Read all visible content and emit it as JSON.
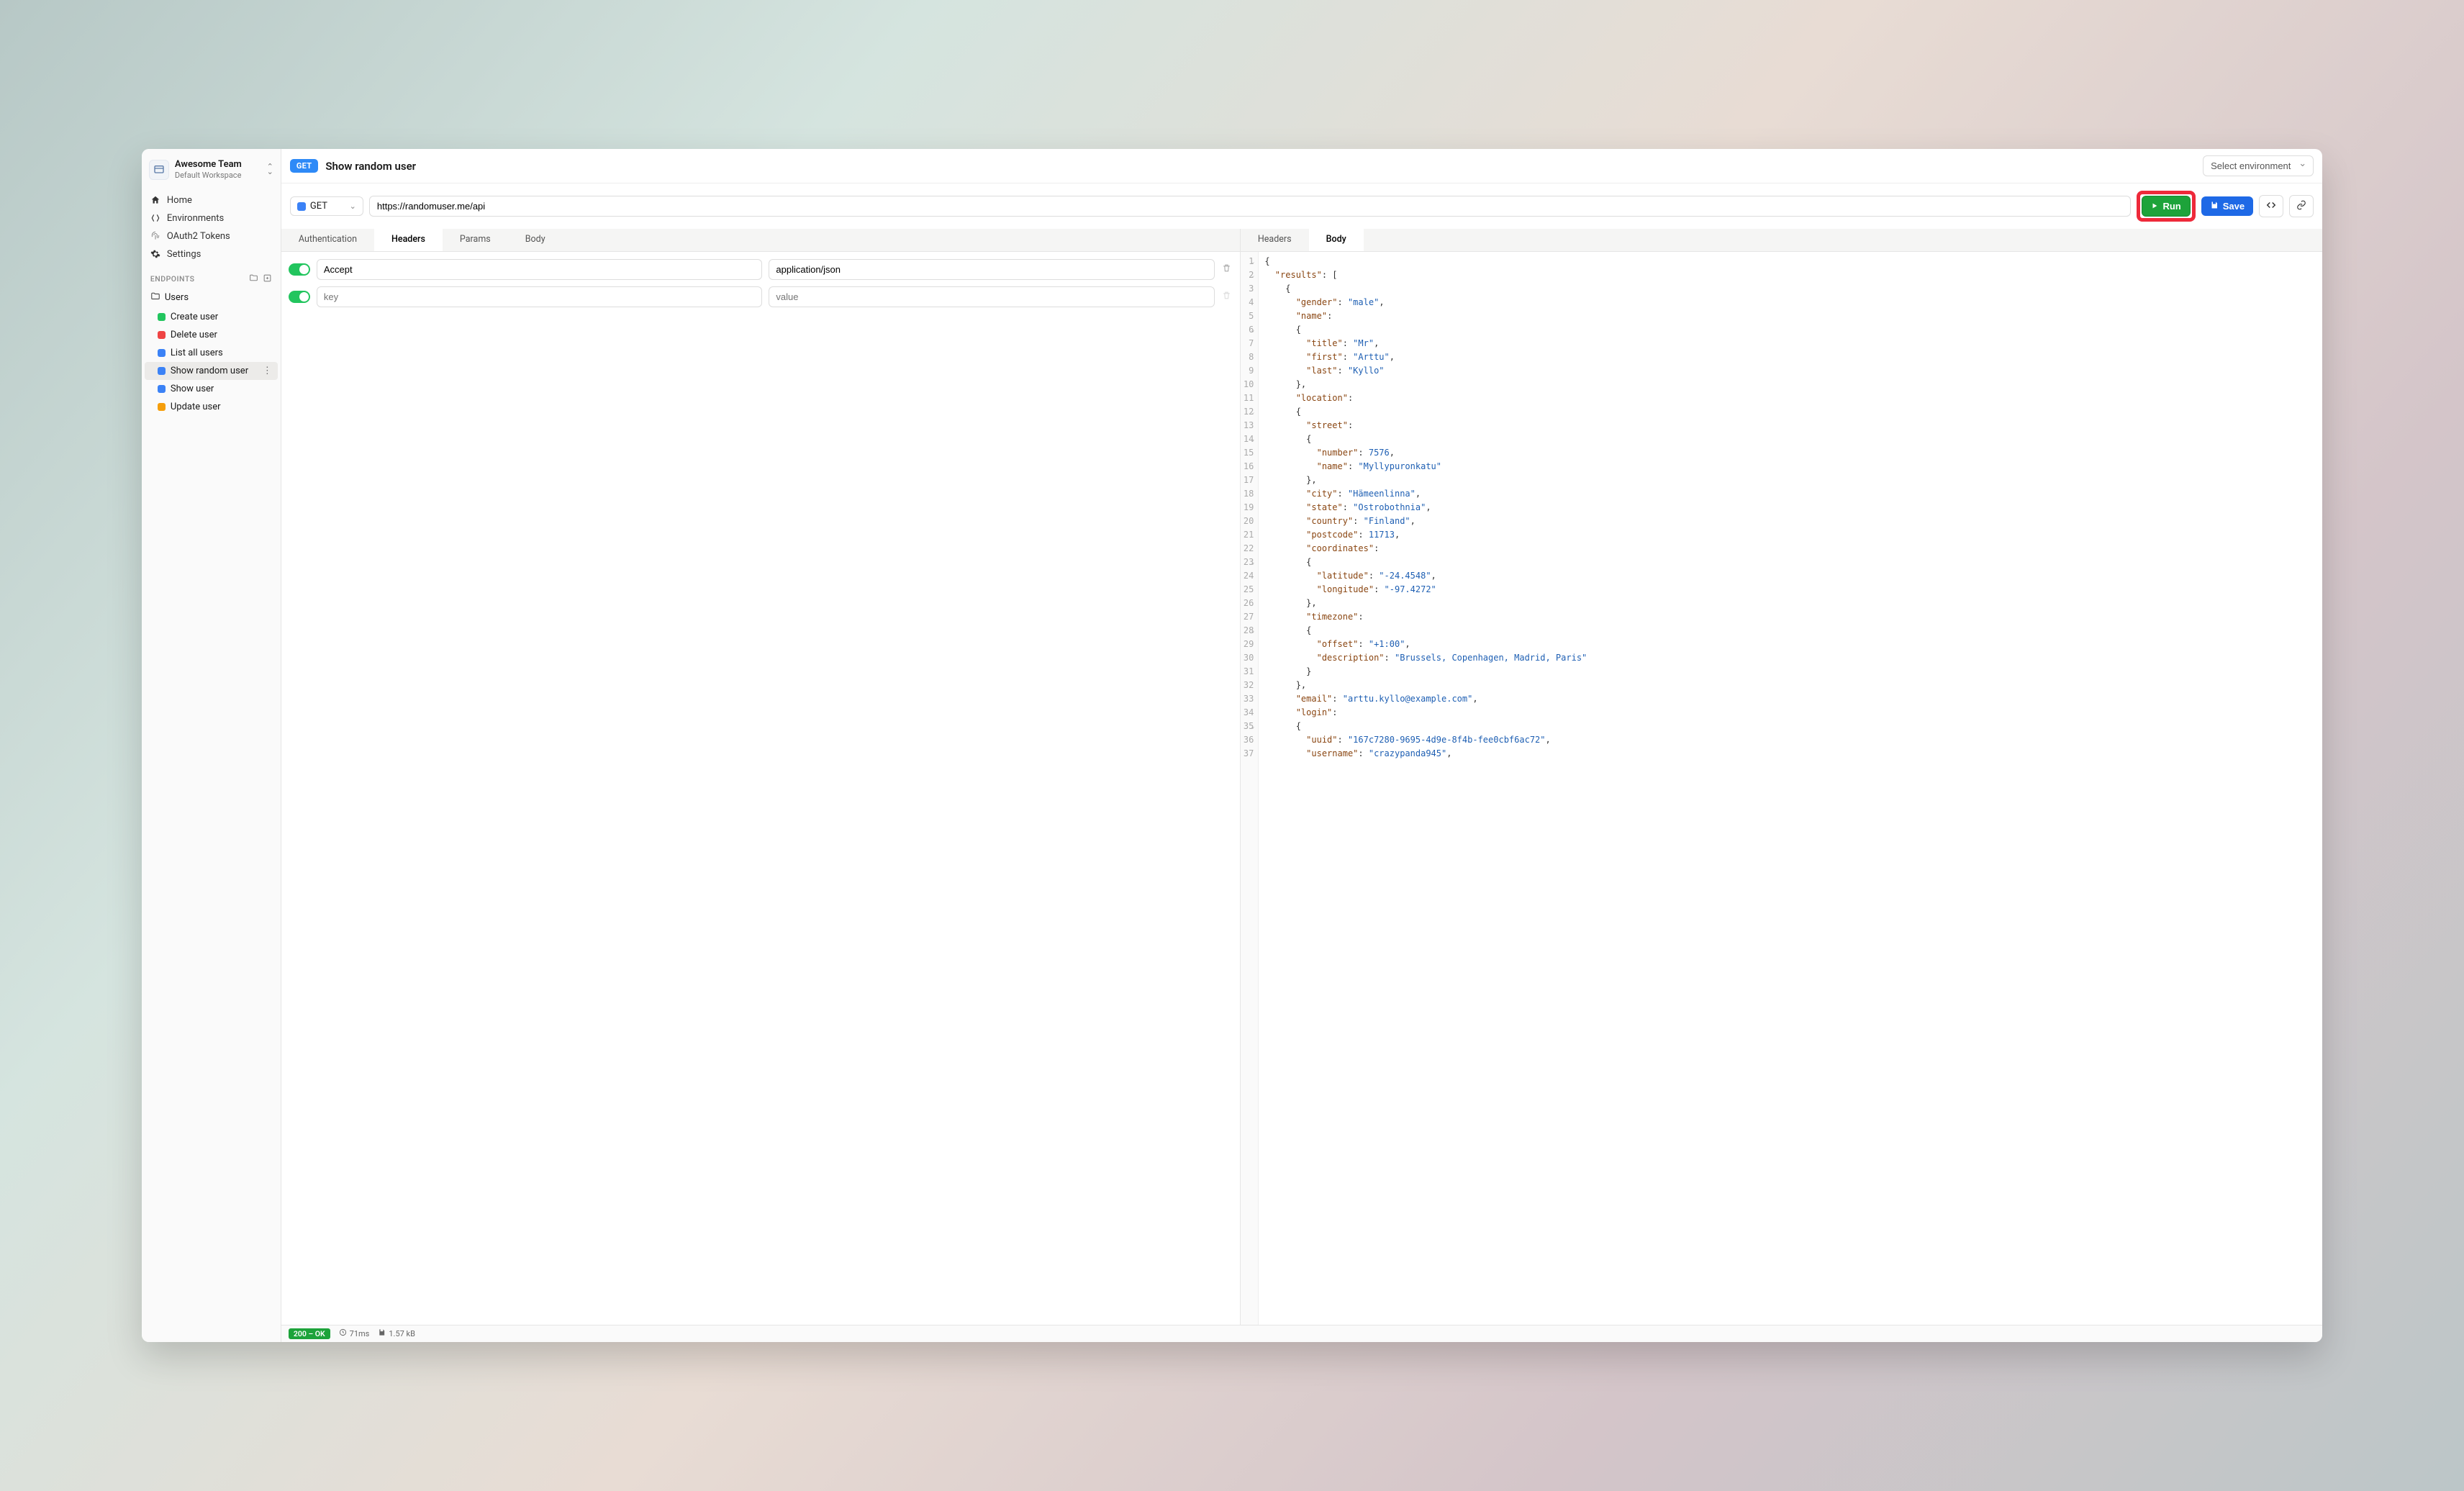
{
  "team": {
    "name": "Awesome Team",
    "workspace": "Default Workspace"
  },
  "nav": {
    "home": "Home",
    "environments": "Environments",
    "oauth": "OAuth2 Tokens",
    "settings": "Settings",
    "endpoints_label": "ENDPOINTS"
  },
  "folder": {
    "users": "Users"
  },
  "endpoints": {
    "create": "Create user",
    "delete": "Delete user",
    "list": "List all users",
    "show_random": "Show random user",
    "show": "Show user",
    "update": "Update user"
  },
  "request": {
    "method_badge": "GET",
    "title": "Show random user",
    "env_placeholder": "Select environment",
    "method": "GET",
    "url": "https://randomuser.me/api",
    "run": "Run",
    "save": "Save"
  },
  "req_tabs": {
    "auth": "Authentication",
    "headers": "Headers",
    "params": "Params",
    "body": "Body"
  },
  "resp_tabs": {
    "headers": "Headers",
    "body": "Body"
  },
  "headers": {
    "key1": "Accept",
    "val1": "application/json",
    "key_ph": "key",
    "val_ph": "value"
  },
  "status": {
    "code": "200 – OK",
    "time": "71ms",
    "size": "1.57 kB"
  },
  "response_lines": [
    {
      "n": 1,
      "fold": true,
      "i": 0,
      "t": [
        {
          "p": "{"
        }
      ]
    },
    {
      "n": 2,
      "fold": true,
      "i": 1,
      "t": [
        {
          "k": "\"results\""
        },
        {
          "p": ": ["
        }
      ]
    },
    {
      "n": 3,
      "i": 2,
      "t": [
        {
          "p": "{"
        }
      ]
    },
    {
      "n": 4,
      "i": 3,
      "t": [
        {
          "k": "\"gender\""
        },
        {
          "p": ": "
        },
        {
          "s": "\"male\""
        },
        {
          "p": ","
        }
      ]
    },
    {
      "n": 5,
      "i": 3,
      "t": [
        {
          "k": "\"name\""
        },
        {
          "p": ":"
        }
      ]
    },
    {
      "n": 6,
      "fold": true,
      "i": 3,
      "t": [
        {
          "p": "{"
        }
      ]
    },
    {
      "n": 7,
      "i": 4,
      "t": [
        {
          "k": "\"title\""
        },
        {
          "p": ": "
        },
        {
          "s": "\"Mr\""
        },
        {
          "p": ","
        }
      ]
    },
    {
      "n": 8,
      "i": 4,
      "t": [
        {
          "k": "\"first\""
        },
        {
          "p": ": "
        },
        {
          "s": "\"Arttu\""
        },
        {
          "p": ","
        }
      ]
    },
    {
      "n": 9,
      "i": 4,
      "t": [
        {
          "k": "\"last\""
        },
        {
          "p": ": "
        },
        {
          "s": "\"Kyllo\""
        }
      ]
    },
    {
      "n": 10,
      "i": 3,
      "t": [
        {
          "p": "},"
        }
      ]
    },
    {
      "n": 11,
      "i": 3,
      "t": [
        {
          "k": "\"location\""
        },
        {
          "p": ":"
        }
      ]
    },
    {
      "n": 12,
      "fold": true,
      "i": 3,
      "t": [
        {
          "p": "{"
        }
      ]
    },
    {
      "n": 13,
      "i": 4,
      "t": [
        {
          "k": "\"street\""
        },
        {
          "p": ":"
        }
      ]
    },
    {
      "n": 14,
      "fold": true,
      "i": 4,
      "t": [
        {
          "p": "{"
        }
      ]
    },
    {
      "n": 15,
      "i": 5,
      "t": [
        {
          "k": "\"number\""
        },
        {
          "p": ": "
        },
        {
          "n_": "7576"
        },
        {
          "p": ","
        }
      ]
    },
    {
      "n": 16,
      "i": 5,
      "t": [
        {
          "k": "\"name\""
        },
        {
          "p": ": "
        },
        {
          "s": "\"Myllypuronkatu\""
        }
      ]
    },
    {
      "n": 17,
      "i": 4,
      "t": [
        {
          "p": "},"
        }
      ]
    },
    {
      "n": 18,
      "i": 4,
      "t": [
        {
          "k": "\"city\""
        },
        {
          "p": ": "
        },
        {
          "s": "\"Hämeenlinna\""
        },
        {
          "p": ","
        }
      ]
    },
    {
      "n": 19,
      "i": 4,
      "t": [
        {
          "k": "\"state\""
        },
        {
          "p": ": "
        },
        {
          "s": "\"Ostrobothnia\""
        },
        {
          "p": ","
        }
      ]
    },
    {
      "n": 20,
      "i": 4,
      "t": [
        {
          "k": "\"country\""
        },
        {
          "p": ": "
        },
        {
          "s": "\"Finland\""
        },
        {
          "p": ","
        }
      ]
    },
    {
      "n": 21,
      "i": 4,
      "t": [
        {
          "k": "\"postcode\""
        },
        {
          "p": ": "
        },
        {
          "n_": "11713"
        },
        {
          "p": ","
        }
      ]
    },
    {
      "n": 22,
      "i": 4,
      "t": [
        {
          "k": "\"coordinates\""
        },
        {
          "p": ":"
        }
      ]
    },
    {
      "n": 23,
      "fold": true,
      "i": 4,
      "t": [
        {
          "p": "{"
        }
      ]
    },
    {
      "n": 24,
      "i": 5,
      "t": [
        {
          "k": "\"latitude\""
        },
        {
          "p": ": "
        },
        {
          "s": "\"-24.4548\""
        },
        {
          "p": ","
        }
      ]
    },
    {
      "n": 25,
      "i": 5,
      "t": [
        {
          "k": "\"longitude\""
        },
        {
          "p": ": "
        },
        {
          "s": "\"-97.4272\""
        }
      ]
    },
    {
      "n": 26,
      "i": 4,
      "t": [
        {
          "p": "},"
        }
      ]
    },
    {
      "n": 27,
      "i": 4,
      "t": [
        {
          "k": "\"timezone\""
        },
        {
          "p": ":"
        }
      ]
    },
    {
      "n": 28,
      "fold": true,
      "i": 4,
      "t": [
        {
          "p": "{"
        }
      ]
    },
    {
      "n": 29,
      "i": 5,
      "t": [
        {
          "k": "\"offset\""
        },
        {
          "p": ": "
        },
        {
          "s": "\"+1:00\""
        },
        {
          "p": ","
        }
      ]
    },
    {
      "n": 30,
      "i": 5,
      "t": [
        {
          "k": "\"description\""
        },
        {
          "p": ": "
        },
        {
          "s": "\"Brussels, Copenhagen, Madrid, Paris\""
        }
      ]
    },
    {
      "n": 31,
      "i": 4,
      "t": [
        {
          "p": "}"
        }
      ]
    },
    {
      "n": 32,
      "i": 3,
      "t": [
        {
          "p": "},"
        }
      ]
    },
    {
      "n": 33,
      "i": 3,
      "t": [
        {
          "k": "\"email\""
        },
        {
          "p": ": "
        },
        {
          "s": "\"arttu.kyllo@example.com\""
        },
        {
          "p": ","
        }
      ]
    },
    {
      "n": 34,
      "i": 3,
      "t": [
        {
          "k": "\"login\""
        },
        {
          "p": ":"
        }
      ]
    },
    {
      "n": 35,
      "fold": true,
      "i": 3,
      "t": [
        {
          "p": "{"
        }
      ]
    },
    {
      "n": 36,
      "i": 4,
      "t": [
        {
          "k": "\"uuid\""
        },
        {
          "p": ": "
        },
        {
          "s": "\"167c7280-9695-4d9e-8f4b-fee0cbf6ac72\""
        },
        {
          "p": ","
        }
      ]
    },
    {
      "n": 37,
      "i": 4,
      "t": [
        {
          "k": "\"username\""
        },
        {
          "p": ": "
        },
        {
          "s": "\"crazypanda945\""
        },
        {
          "p": ","
        }
      ]
    }
  ]
}
